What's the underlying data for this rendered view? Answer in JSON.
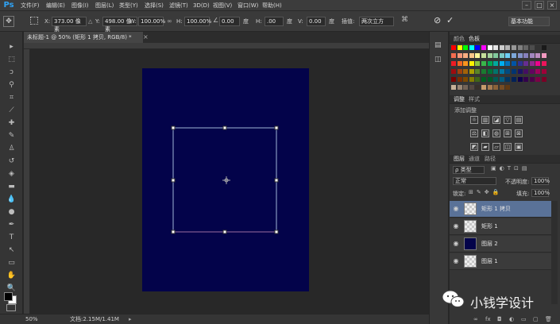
{
  "app": {
    "logo": "Ps"
  },
  "menu": [
    "文件(F)",
    "编辑(E)",
    "图像(I)",
    "图层(L)",
    "类型(Y)",
    "选择(S)",
    "滤镜(T)",
    "3D(D)",
    "视图(V)",
    "窗口(W)",
    "帮助(H)"
  ],
  "window_controls": {
    "minimize": "–",
    "restore": "□",
    "close": "×"
  },
  "options": {
    "x_label": "X:",
    "x_value": "373.00 像素",
    "y_label": "Y:",
    "y_value": "498.00 像素",
    "w_label": "W:",
    "w_value": "100.00%",
    "h_label": "H:",
    "h_value": "100.00%",
    "angle_value": "0.00",
    "deg1": "度",
    "hskew_label": "H:",
    "hskew_value": ".00",
    "deg2": "度",
    "vskew_label": "V:",
    "vskew_value": "0.00",
    "deg3": "度",
    "interp_label": "插值:",
    "interp_value": "两次立方",
    "workspace": "基本功能"
  },
  "document": {
    "tab_title": "未标题-1 @ 50% (矩形 1 拷贝, RGB/8) *",
    "canvas_color": "#03034a",
    "transform_color": "#9fb6d6"
  },
  "status": {
    "zoom": "50%",
    "doc_info": "文档:2.15M/1.41M"
  },
  "swatches": {
    "tabs": [
      "颜色",
      "色板"
    ],
    "colors": [
      "#ff0000",
      "#ffff00",
      "#00ff00",
      "#00ffff",
      "#0000ff",
      "#ff00ff",
      "#ffffff",
      "#e6e6e6",
      "#cccccc",
      "#b3b3b3",
      "#999999",
      "#808080",
      "#666666",
      "#4d4d4d",
      "#333333",
      "#1a1a1a",
      "#f26c4f",
      "#f69679",
      "#f9ad81",
      "#fdc689",
      "#fff799",
      "#c4df9b",
      "#a3d39c",
      "#82ca9d",
      "#7accc8",
      "#6dcff6",
      "#7da7d9",
      "#8393ca",
      "#8781bd",
      "#a186be",
      "#bd8cbf",
      "#f49ac1",
      "#ed1c24",
      "#f26522",
      "#f7941d",
      "#fff200",
      "#8dc63f",
      "#39b54a",
      "#00a651",
      "#00a99d",
      "#00aeef",
      "#0072bc",
      "#0054a6",
      "#2e3192",
      "#662d91",
      "#92278f",
      "#ec008c",
      "#ed145b",
      "#9e0b0f",
      "#a0410d",
      "#a36209",
      "#aba000",
      "#598527",
      "#1a7b30",
      "#007236",
      "#00746b",
      "#0076a3",
      "#004b80",
      "#003471",
      "#1b1464",
      "#440e62",
      "#630460",
      "#9e005d",
      "#9e0039",
      "#790000",
      "#7b2e00",
      "#7d4900",
      "#827b00",
      "#406618",
      "#005e20",
      "#005826",
      "#005952",
      "#005b7f",
      "#003663",
      "#002157",
      "#0d004c",
      "#32004b",
      "#4b0049",
      "#7b0046",
      "#7a0026",
      "#c7b299",
      "#998675",
      "#736357",
      "#534741",
      "#37302a",
      "#c69c6d",
      "#a67c52",
      "#8c6239",
      "#754c24",
      "#603913"
    ]
  },
  "adjustments": {
    "tabs": [
      "调整",
      "样式"
    ],
    "subtitle": "添加调整",
    "icons": [
      "☼",
      "▥",
      "◪",
      "▽",
      "▤",
      "⚖",
      "◧",
      "◍",
      "⊞",
      "⊠",
      "◩",
      "▰",
      "▱",
      "◫",
      "▣"
    ]
  },
  "layers_panel": {
    "tabs": [
      "图层",
      "通道",
      "路径"
    ],
    "kind": "ρ 类型",
    "blend": "正常",
    "opacity_label": "不透明度:",
    "opacity": "100%",
    "lock_label": "锁定:",
    "fill_label": "填充:",
    "fill": "100%",
    "layers": [
      {
        "name": "矩形 1 拷贝",
        "selected": true,
        "thumb": "checker"
      },
      {
        "name": "矩形 1",
        "selected": false,
        "thumb": "checker"
      },
      {
        "name": "图层 2",
        "selected": false,
        "thumb": "#03034a"
      },
      {
        "name": "图层 1",
        "selected": false,
        "thumb": "checker"
      }
    ],
    "footer_icons": [
      "∞",
      "fx",
      "◘",
      "◐",
      "▭",
      "▢",
      "🗑"
    ]
  },
  "watermark": {
    "text": "小钱学设计"
  }
}
